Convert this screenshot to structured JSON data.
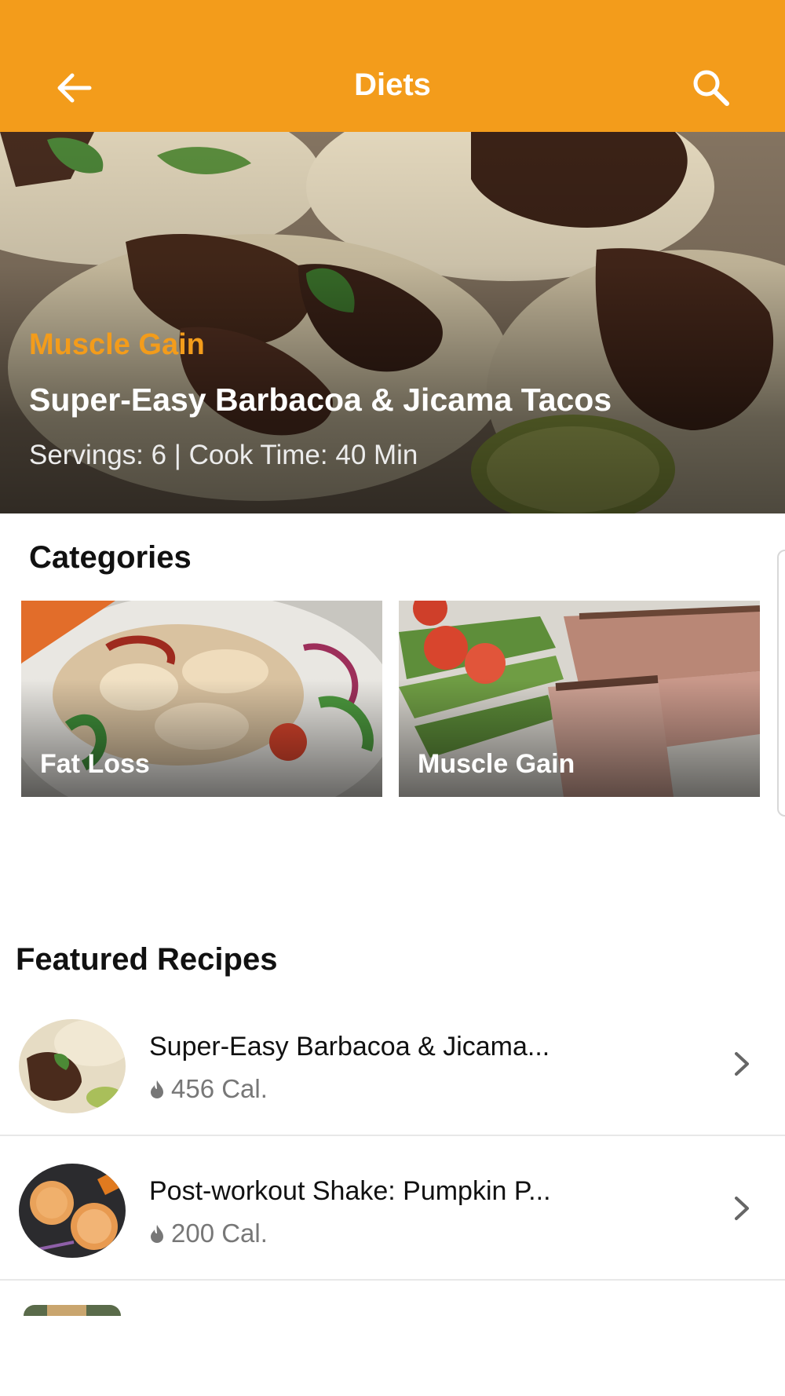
{
  "header": {
    "title": "Diets",
    "back_icon": "arrow-left-icon",
    "search_icon": "search-icon",
    "background": "#f39c1b"
  },
  "hero": {
    "category": "Muscle Gain",
    "title": "Super-Easy Barbacoa & Jicama Tacos",
    "meta": "Servings: 6 | Cook Time: 40 Min"
  },
  "categories": {
    "heading": "Categories",
    "items": [
      {
        "label": "Fat Loss"
      },
      {
        "label": "Muscle Gain"
      }
    ]
  },
  "featured": {
    "heading": "Featured Recipes",
    "items": [
      {
        "name": "Super-Easy Barbacoa & Jicama...",
        "calories": "456 Cal."
      },
      {
        "name": "Post-workout Shake: Pumpkin P...",
        "calories": "200 Cal."
      }
    ]
  },
  "colors": {
    "accent": "#f39c1b",
    "calorie_text": "#777777"
  }
}
